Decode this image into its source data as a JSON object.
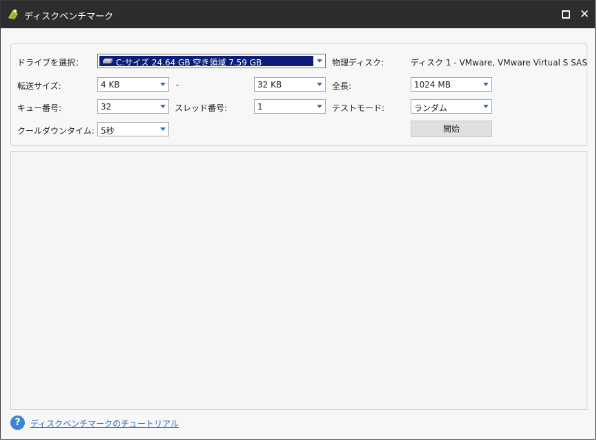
{
  "window": {
    "title": "ディスクベンチマーク",
    "maximize_icon": "maximize-icon",
    "close_icon": "close-icon",
    "close_glyph": "✕"
  },
  "settings": {
    "drive": {
      "label": "ドライブを選択：",
      "value": "C:サイズ 24.64 GB 空き領域 7.59 GB",
      "icon": "disk-drive-icon"
    },
    "physical_disk": {
      "label": "物理ディスク:",
      "value": "ディスク 1 - VMware, VMware Virtual S SAS"
    },
    "transfer_size": {
      "label": "転送サイズ:",
      "min_value": "4 KB",
      "separator": "-",
      "max_value": "32 KB"
    },
    "total_length": {
      "label": "全長:",
      "value": "1024 MB"
    },
    "queue_number": {
      "label": "キュー番号:",
      "value": "32"
    },
    "thread_number": {
      "label": "スレッド番号:",
      "value": "1"
    },
    "test_mode": {
      "label": "テストモード:",
      "value": "ランダム"
    },
    "cooldown_time": {
      "label": "クールダウンタイム:",
      "value": "5秒"
    },
    "start_button": "開始"
  },
  "footer": {
    "help_glyph": "?",
    "tutorial_link": "ディスクベンチマークのチュートリアル"
  },
  "colors": {
    "titlebar": "#2d2d2d",
    "selection": "#0a1e7a",
    "accent": "#2f6fba",
    "link": "#2b6fc4"
  }
}
